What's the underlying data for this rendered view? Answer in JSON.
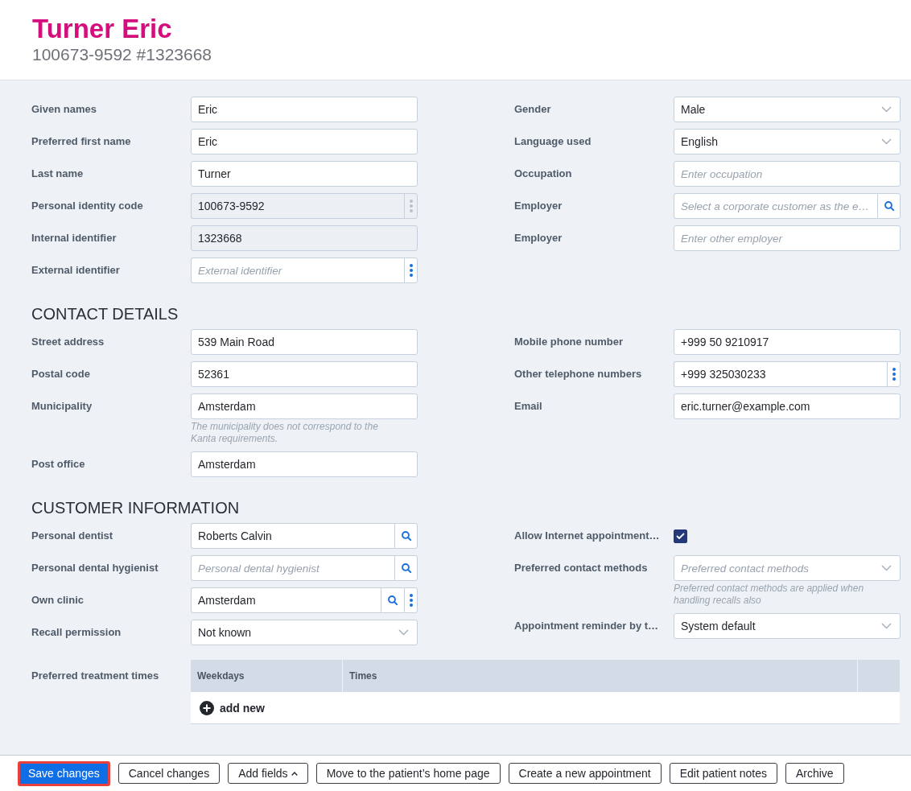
{
  "header": {
    "name": "Turner Eric",
    "subtitle": "100673-9592 #1323668"
  },
  "sections": [
    {
      "left": [
        {
          "label": "Given names",
          "kind": "text",
          "value": "Eric",
          "readonly": false
        },
        {
          "label": "Preferred first name",
          "kind": "text",
          "value": "Eric",
          "readonly": false
        },
        {
          "label": "Last name",
          "kind": "text",
          "value": "Turner",
          "readonly": false
        },
        {
          "label": "Personal identity code",
          "kind": "menu",
          "value": "100673-9592",
          "readonly": true
        },
        {
          "label": "Internal identifier",
          "kind": "text",
          "value": "1323668",
          "readonly": true
        },
        {
          "label": "External identifier",
          "kind": "menu",
          "placeholder": "External identifier",
          "readonly": false
        }
      ],
      "right": [
        {
          "label": "Gender",
          "kind": "select",
          "value": "Male",
          "readonly": false
        },
        {
          "label": "Language used",
          "kind": "select",
          "value": "English",
          "readonly": false
        },
        {
          "label": "Occupation",
          "kind": "text",
          "placeholder": "Enter occupation",
          "readonly": false
        },
        {
          "label": "Employer",
          "kind": "search",
          "placeholder": "Select a corporate customer as the e…",
          "readonly": false
        },
        {
          "label": "Employer",
          "kind": "text",
          "placeholder": "Enter other employer",
          "readonly": false
        }
      ]
    },
    {
      "title": "CONTACT DETAILS",
      "left": [
        {
          "label": "Street address",
          "kind": "text",
          "value": "539 Main Road",
          "readonly": false
        },
        {
          "label": "Postal code",
          "kind": "text",
          "value": "52361",
          "readonly": false
        },
        {
          "label": "Municipality",
          "kind": "text",
          "value": "Amsterdam",
          "readonly": false,
          "hint": "The municipality does not correspond to the Kanta requirements."
        },
        {
          "label": "Post office",
          "kind": "text",
          "value": "Amsterdam",
          "readonly": false
        }
      ],
      "right": [
        {
          "label": "Mobile phone number",
          "kind": "text",
          "value": "+999 50 9210917",
          "readonly": false
        },
        {
          "label": "Other telephone numbers",
          "kind": "menu",
          "value": "+999 325030233",
          "readonly": false
        },
        {
          "label": "Email",
          "kind": "text",
          "value": "eric.turner@example.com",
          "readonly": false
        }
      ]
    },
    {
      "title": "CUSTOMER INFORMATION",
      "left": [
        {
          "label": "Personal dentist",
          "kind": "search",
          "value": "Roberts Calvin",
          "readonly": false
        },
        {
          "label": "Personal dental hygienist",
          "kind": "search",
          "placeholder": "Personal dental hygienist",
          "readonly": false
        },
        {
          "label": "Own clinic",
          "kind": "search_menu",
          "value": "Amsterdam",
          "readonly": false
        },
        {
          "label": "Recall permission",
          "kind": "select",
          "value": "Not known",
          "readonly": false
        }
      ],
      "right": [
        {
          "label": "Allow Internet appointment…",
          "kind": "checkbox",
          "checked": true
        },
        {
          "label": "Preferred contact methods",
          "kind": "select",
          "placeholder": "Preferred contact methods",
          "readonly": false,
          "hint": "Preferred contact methods are applied when handling recalls also"
        },
        {
          "label": "Appointment reminder by t…",
          "kind": "select",
          "value": "System default",
          "readonly": false
        }
      ]
    }
  ],
  "treatment_times": {
    "label": "Preferred treatment times",
    "columns": [
      "Weekdays",
      "Times"
    ],
    "add_label": "add new"
  },
  "footer": {
    "buttons": [
      {
        "label": "Save changes",
        "kind": "primary",
        "focused": true
      },
      {
        "label": "Cancel changes",
        "kind": "plain",
        "focused": false
      },
      {
        "label": "Add fields",
        "kind": "menu",
        "focused": false
      },
      {
        "label": "Move to the patient’s home page",
        "kind": "plain",
        "focused": false
      },
      {
        "label": "Create a new appointment",
        "kind": "plain",
        "focused": false
      },
      {
        "label": "Edit patient notes",
        "kind": "plain",
        "focused": false
      },
      {
        "label": "Archive",
        "kind": "plain",
        "focused": false
      }
    ]
  }
}
